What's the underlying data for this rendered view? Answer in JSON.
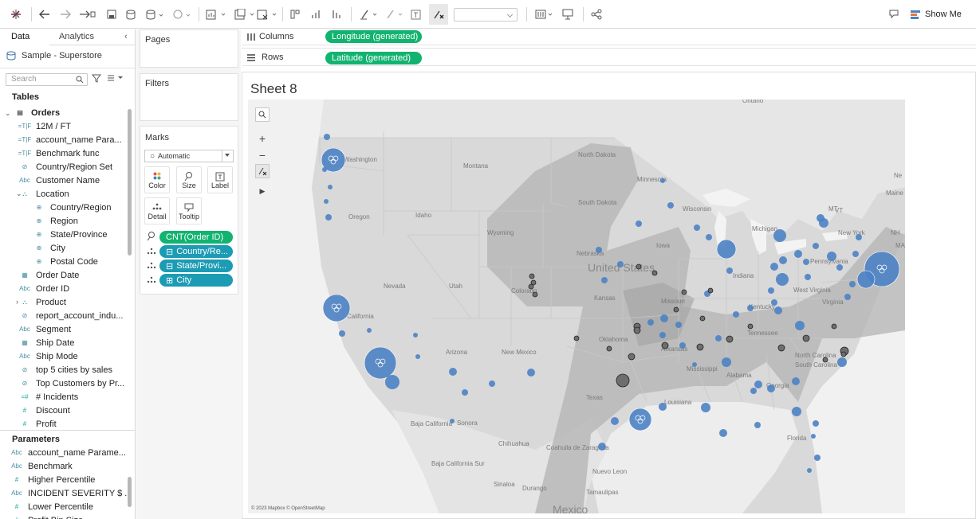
{
  "toolbar": {
    "show_me": "Show Me"
  },
  "data_pane": {
    "tabs": [
      "Data",
      "Analytics"
    ],
    "source": "Sample - Superstore",
    "search_placeholder": "Search",
    "tables_heading": "Tables",
    "table_name": "Orders",
    "fields": [
      {
        "label": "12M / FT",
        "icon": "=T|F"
      },
      {
        "label": "account_name Para...",
        "icon": "=T|F"
      },
      {
        "label": "Benchmark func",
        "icon": "=T|F"
      },
      {
        "label": "Country/Region Set",
        "icon": "set"
      },
      {
        "label": "Customer Name",
        "icon": "Abc"
      },
      {
        "label": "Location",
        "icon": "hier"
      },
      {
        "label": "Country/Region",
        "icon": "globe"
      },
      {
        "label": "Region",
        "icon": "globe"
      },
      {
        "label": "State/Province",
        "icon": "globe"
      },
      {
        "label": "City",
        "icon": "globe"
      },
      {
        "label": "Postal Code",
        "icon": "globe"
      },
      {
        "label": "Order Date",
        "icon": "date"
      },
      {
        "label": "Order ID",
        "icon": "Abc"
      },
      {
        "label": "Product",
        "icon": "hier"
      },
      {
        "label": "report_account_indu...",
        "icon": "set"
      },
      {
        "label": "Segment",
        "icon": "Abc"
      },
      {
        "label": "Ship Date",
        "icon": "date"
      },
      {
        "label": "Ship Mode",
        "icon": "Abc"
      },
      {
        "label": "top 5 cities by sales",
        "icon": "set"
      },
      {
        "label": "Top Customers by Pr...",
        "icon": "set"
      },
      {
        "label": "# Incidents",
        "icon": "=#"
      },
      {
        "label": "Discount",
        "icon": "#"
      },
      {
        "label": "Profit",
        "icon": "#"
      }
    ],
    "parameters_heading": "Parameters",
    "parameters": [
      {
        "label": "account_name Parame...",
        "icon": "Abc"
      },
      {
        "label": "Benchmark",
        "icon": "Abc"
      },
      {
        "label": "Higher Percentile",
        "icon": "#"
      },
      {
        "label": "INCIDENT SEVERITY $ ...",
        "icon": "Abc"
      },
      {
        "label": "Lower Percentile",
        "icon": "#"
      },
      {
        "label": "Profit Bin Size",
        "icon": "#"
      }
    ]
  },
  "cards": {
    "pages": "Pages",
    "filters": "Filters",
    "marks": "Marks",
    "mark_type": "Automatic",
    "mark_buttons": [
      "Color",
      "Size",
      "Label",
      "Detail",
      "Tooltip"
    ],
    "mark_pills": [
      "CNT(Order ID)",
      "Country/Re...",
      "State/Provi...",
      "City"
    ]
  },
  "shelves": {
    "columns_label": "Columns",
    "columns_pill": "Longitude (generated)",
    "rows_label": "Rows",
    "rows_pill": "Latitude (generated)"
  },
  "sheet": {
    "title": "Sheet 8",
    "copyright": "© 2023 Mapbox © OpenStreetMap"
  },
  "map_labels": [
    "Ontario",
    "Washington",
    "Montana",
    "North Dakota",
    "Minnesota",
    "Maine",
    "Wisconsin",
    "South Dakota",
    "Oregon",
    "Idaho",
    "Wyoming",
    "Michigan",
    "New York",
    "Iowa",
    "Nebraska",
    "Pennsylvania",
    "United States",
    "Nevada",
    "Utah",
    "Colorado",
    "Kansas",
    "Missouri",
    "Indiana",
    "West Virginia",
    "Virginia",
    "Kentucky",
    "California",
    "Tennessee",
    "Oklahoma",
    "Arkansas",
    "North Carolina",
    "Arizona",
    "New Mexico",
    "South Carolina",
    "Mississippi",
    "Alabama",
    "Georgia",
    "Texas",
    "Louisiana",
    "Florida",
    "Baja California",
    "Sonora",
    "Chihuahua",
    "Coahuila de Zaragoza",
    "Nuevo Leon",
    "Baja California Sur",
    "Sinaloa",
    "Durango",
    "Tamaulipas",
    "Mexico",
    "MT",
    "VT",
    "NH",
    "MA",
    "Ne"
  ],
  "colors": {
    "accent_green": "#12b370",
    "pill_teal": "#1c9bb4",
    "mark_blue": "#4c82c4",
    "map_bg": "#dadada"
  }
}
